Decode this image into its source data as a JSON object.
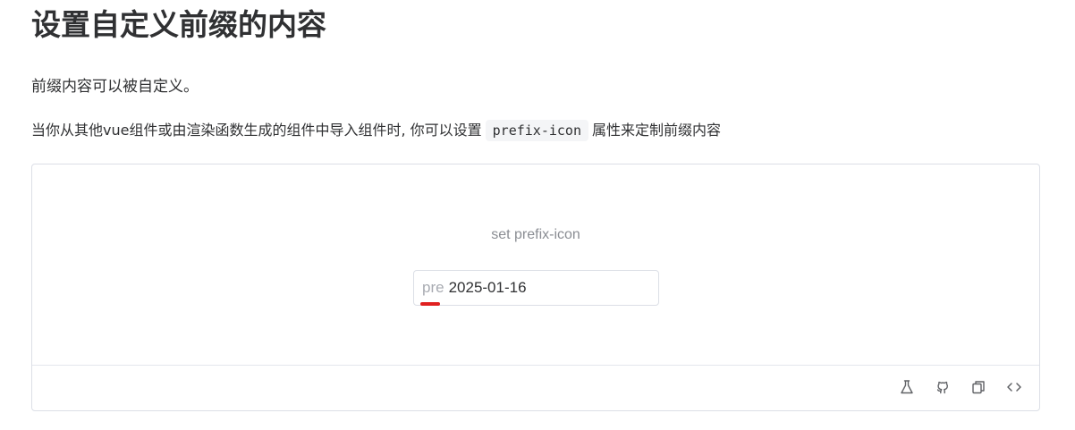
{
  "header": {
    "title": "设置自定义前缀的内容"
  },
  "content": {
    "intro": "前缀内容可以被自定义。",
    "description_before": "当你从其他vue组件或由渲染函数生成的组件中导入组件时, 你可以设置",
    "code": "prefix-icon",
    "description_after": "属性来定制前缀内容"
  },
  "demo": {
    "caption": "set prefix-icon",
    "input": {
      "prefix": "pre",
      "value": "2025-01-16"
    },
    "toolbar": {
      "icons": [
        "playground-icon",
        "github-icon",
        "copy-icon",
        "code-icon"
      ]
    }
  }
}
